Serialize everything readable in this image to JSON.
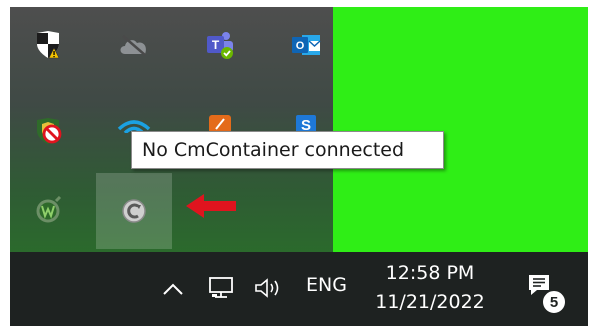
{
  "tooltip": {
    "text": "No CmContainer connected"
  },
  "taskbar": {
    "language": "ENG",
    "time": "12:58 PM",
    "date": "11/21/2022",
    "notification_count": "5"
  },
  "tray_icons": [
    {
      "name": "windows-security-warning-icon"
    },
    {
      "name": "onedrive-offline-icon"
    },
    {
      "name": "teams-icon"
    },
    {
      "name": "outlook-icon"
    },
    {
      "name": "antivirus-blocked-icon"
    },
    {
      "name": "wifi-icon"
    },
    {
      "name": "orange-app-icon"
    },
    {
      "name": "skype-icon"
    },
    {
      "name": "green-app-icon"
    },
    {
      "name": "codemeter-icon"
    }
  ],
  "colors": {
    "desktop": "#2fee16",
    "taskbar": "#1e2221",
    "arrow": "#e0141e"
  }
}
